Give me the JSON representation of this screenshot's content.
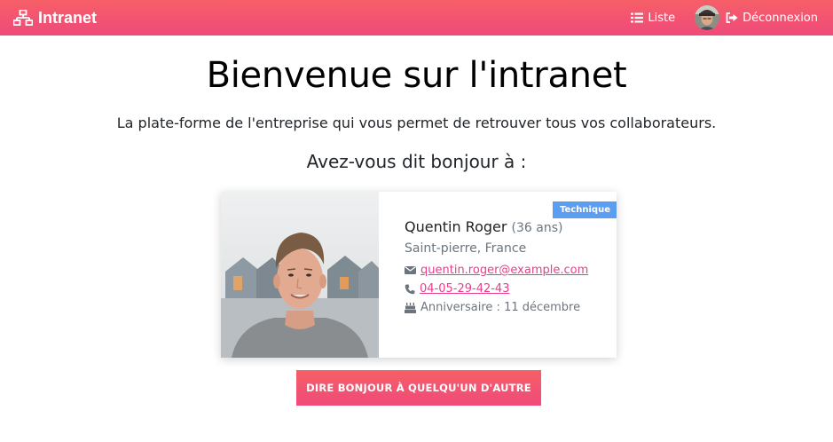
{
  "navbar": {
    "brand": "Intranet",
    "list_label": "Liste",
    "logout_label": "Déconnexion",
    "color_start": "#f65f67",
    "color_end": "#ef4a7a"
  },
  "hero": {
    "title": "Bienvenue sur l'intranet",
    "lead": "La plate-forme de l'entreprise qui vous permet de retrouver tous vos collaborateurs.",
    "subhead": "Avez-vous dit bonjour à :"
  },
  "card": {
    "badge": "Technique",
    "badge_color": "#5b9df1",
    "name": "Quentin Roger",
    "age": "(36 ans)",
    "location": "Saint-pierre, France",
    "email": "quentin.roger@example.com",
    "phone": "04-05-29-42-43",
    "birthday": "Anniversaire : 11 décembre",
    "link_color": "#e83e8c"
  },
  "cta": {
    "label": "DIRE BONJOUR À QUELQU'UN D'AUTRE"
  }
}
